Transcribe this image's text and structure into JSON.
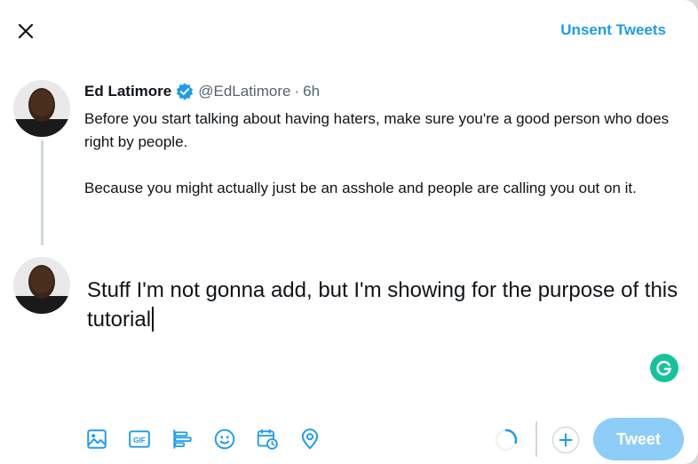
{
  "header": {
    "close_icon": "close-icon",
    "unsent_label": "Unsent Tweets"
  },
  "quoted_tweet": {
    "author_name": "Ed Latimore",
    "verified_icon": "verified-badge-icon",
    "handle": "@EdLatimore",
    "separator": "·",
    "time": "6h",
    "text_p1": "Before you start talking about having haters, make sure you're a good person who does right by people.",
    "text_p2": "Because you might actually just be an asshole and people are calling you out on it."
  },
  "composer": {
    "text": "Stuff I'm not gonna add, but I'm showing for the purpose of this tutorial",
    "grammarly_icon": "grammarly-icon"
  },
  "toolbar": {
    "items": [
      {
        "icon": "image-icon"
      },
      {
        "icon": "gif-icon",
        "label": "GIF"
      },
      {
        "icon": "poll-icon"
      },
      {
        "icon": "emoji-icon"
      },
      {
        "icon": "schedule-icon"
      },
      {
        "icon": "location-icon"
      }
    ],
    "tweet_label": "Tweet"
  },
  "colors": {
    "accent": "#1d9bf0",
    "tweet_button_disabled": "#8ecdf8",
    "grammarly": "#15c39a"
  }
}
